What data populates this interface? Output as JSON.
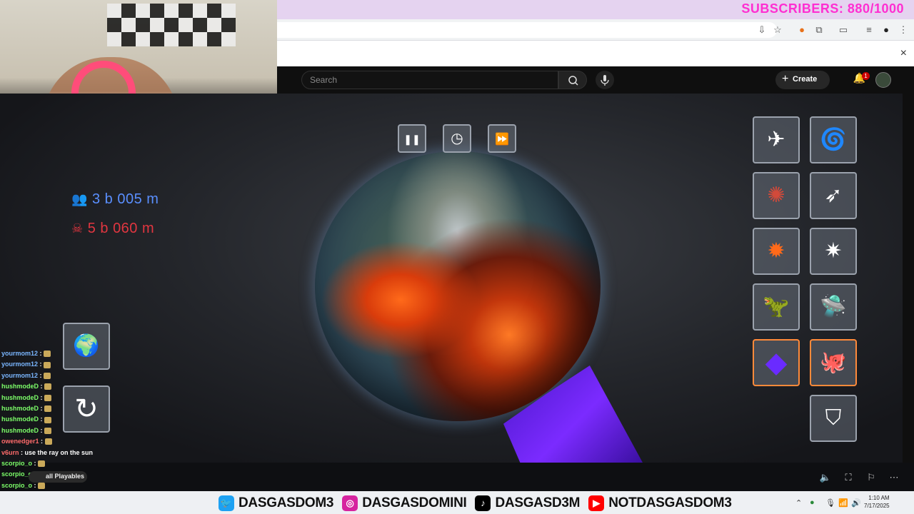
{
  "banner": {
    "subscribers": "SUBSCRIBERS: 880/1000"
  },
  "browser": {
    "close_icon": "×"
  },
  "youtube": {
    "search_placeholder": "Search",
    "create_label": "Create",
    "notification_count": "1"
  },
  "game": {
    "controls": [
      {
        "name": "pause-button",
        "icon": "pause-icon",
        "glyph": "❚❚"
      },
      {
        "name": "time-button",
        "icon": "clock-icon",
        "glyph": "◷"
      },
      {
        "name": "fast-forward-button",
        "icon": "fast-forward-icon",
        "glyph": "⏩"
      }
    ],
    "population": "3 b 005 m",
    "deaths": "5 b 060 m",
    "tools": [
      {
        "name": "tool-ships",
        "icon": "ufo-fleet-icon",
        "glyph": "✈"
      },
      {
        "name": "tool-blackhole",
        "icon": "spiral-icon",
        "glyph": "🌀"
      },
      {
        "name": "tool-virus",
        "icon": "virus-icon",
        "glyph": "✺"
      },
      {
        "name": "tool-ray",
        "icon": "ray-gun-icon",
        "glyph": "➶"
      },
      {
        "name": "tool-explosion",
        "icon": "explosion-icon",
        "glyph": "✹"
      },
      {
        "name": "tool-freeze",
        "icon": "burst-icon",
        "glyph": "✷"
      },
      {
        "name": "tool-laser-dino",
        "icon": "laser-dinosaur-icon",
        "glyph": "🦖"
      },
      {
        "name": "tool-ufo",
        "icon": "ufo-icon",
        "glyph": "🛸"
      },
      {
        "name": "tool-crystal",
        "icon": "crystal-icon",
        "glyph": "◆",
        "selected": true
      },
      {
        "name": "tool-octopus",
        "icon": "octopus-icon",
        "glyph": "🐙",
        "selected": true
      },
      {
        "name": "tool-shield",
        "icon": "shield-icon",
        "glyph": "⛉"
      }
    ],
    "left_buttons": [
      {
        "name": "planet-select-button",
        "icon": "earth-icon",
        "glyph": "🌍"
      },
      {
        "name": "reset-button",
        "icon": "refresh-icon",
        "glyph": "↻"
      }
    ]
  },
  "chat": [
    {
      "user": "yourmom12",
      "msg": "",
      "color": "user"
    },
    {
      "user": "yourmom12",
      "msg": "",
      "color": "user"
    },
    {
      "user": "yourmom12",
      "msg": "",
      "color": "user"
    },
    {
      "user": "hushmodeD",
      "msg": "",
      "color": "g"
    },
    {
      "user": "hushmodeD",
      "msg": "",
      "color": "g"
    },
    {
      "user": "hushmodeD",
      "msg": "",
      "color": "g"
    },
    {
      "user": "hushmodeD",
      "msg": "",
      "color": "g"
    },
    {
      "user": "hushmodeD",
      "msg": "",
      "color": "g"
    },
    {
      "user": "owenedger1",
      "msg": "",
      "color": "r"
    },
    {
      "user": "v6urn",
      "msg": "use the ray on the sun",
      "color": "r"
    },
    {
      "user": "scorpio_o",
      "msg": "",
      "color": "g"
    },
    {
      "user": "scorpio_o",
      "msg": "",
      "color": "g"
    },
    {
      "user": "scorpio_o",
      "msg": "",
      "color": "g"
    },
    {
      "user": "scorpio_o",
      "msg": "",
      "color": "g"
    },
    {
      "user": "scorpio_o",
      "msg": "",
      "color": "g"
    }
  ],
  "playables_label": "all Playables",
  "socials": [
    {
      "icon": "twitter-icon",
      "glyph": "🐦",
      "bg": "#1da1f2",
      "handle": "DASGASDOM3"
    },
    {
      "icon": "instagram-icon",
      "glyph": "◎",
      "bg": "#d6249f",
      "handle": "DASGASDOMINI"
    },
    {
      "icon": "tiktok-icon",
      "glyph": "♪",
      "bg": "#000000",
      "handle": "DASGASD3M"
    },
    {
      "icon": "youtube-icon",
      "glyph": "▶",
      "bg": "#ff0000",
      "handle": "NOTDASGASDOM3"
    }
  ],
  "clock": {
    "time": "1:10 AM",
    "date": "7/17/2025"
  }
}
